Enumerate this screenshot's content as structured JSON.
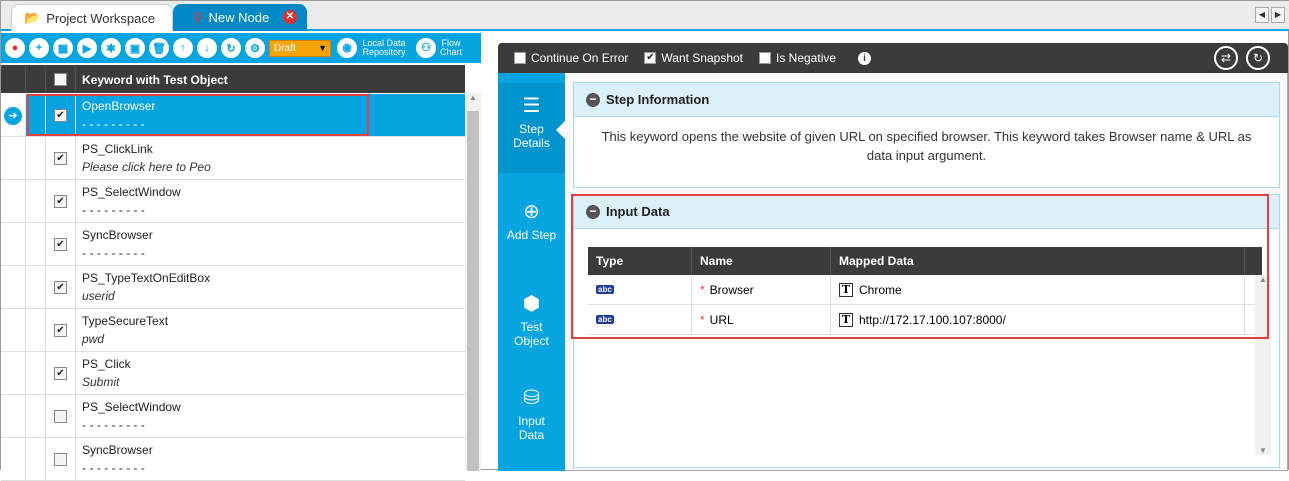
{
  "tabs": [
    {
      "label": "Project Workspace"
    },
    {
      "label": "New Node"
    }
  ],
  "toolbar": {
    "status": "Draft",
    "local_repo": "Local Data Repository",
    "flow_chart": "Flow Chart"
  },
  "grid": {
    "header": "Keyword with Test Object",
    "rows": [
      {
        "keyword": "OpenBrowser",
        "object": "- - - - - - - - -",
        "checked": true
      },
      {
        "keyword": "PS_ClickLink",
        "object": "Please click here to Peo",
        "checked": true
      },
      {
        "keyword": "PS_SelectWindow",
        "object": "- - - - - - - - -",
        "checked": true
      },
      {
        "keyword": "SyncBrowser",
        "object": "- - - - - - - - -",
        "checked": true
      },
      {
        "keyword": "PS_TypeTextOnEditBox",
        "object": "userid",
        "checked": true
      },
      {
        "keyword": "TypeSecureText",
        "object": "pwd",
        "checked": true
      },
      {
        "keyword": "PS_Click",
        "object": "Submit",
        "checked": true
      },
      {
        "keyword": "PS_SelectWindow",
        "object": "- - - - - - - - -",
        "checked": false
      },
      {
        "keyword": "SyncBrowser",
        "object": "- - - - - - - - -",
        "checked": false
      }
    ]
  },
  "options": {
    "continue_on_error": "Continue On Error",
    "want_snapshot": "Want Snapshot",
    "is_negative": "Is Negative"
  },
  "nav": {
    "step_details": "Step Details",
    "add_step": "Add Step",
    "test_object": "Test Object",
    "input_data": "Input Data"
  },
  "step_info": {
    "title": "Step Information",
    "text": "This keyword opens the website of given URL on specified browser. This keyword takes Browser name & URL as data input argument."
  },
  "input_data": {
    "title": "Input Data",
    "columns": {
      "type": "Type",
      "name": "Name",
      "mapped": "Mapped Data"
    },
    "type_badge": "abc",
    "rows": [
      {
        "name": "Browser",
        "mapped": "Chrome"
      },
      {
        "name": "URL",
        "mapped": "http://172.17.100.107:8000/"
      }
    ]
  },
  "colors": {
    "accent": "#06a4e0",
    "dark": "#3b3b3b",
    "highlight": "#e04040"
  }
}
